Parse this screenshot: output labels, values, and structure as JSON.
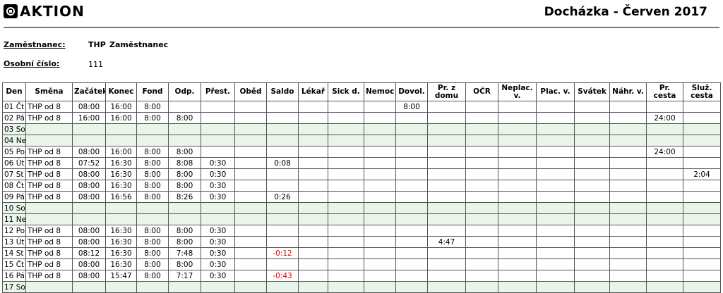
{
  "header": {
    "logo_text": "AKTION",
    "title": "Docházka - Červen 2017"
  },
  "info": {
    "employee_label": "Zaměstnanec:",
    "employee_short": "THP",
    "employee_name": "Zaměstnanec",
    "id_label": "Osobní číslo:",
    "id_value": "111"
  },
  "columns": [
    "Den",
    "Směna",
    "Začátek",
    "Konec",
    "Fond",
    "Odp.",
    "Přest.",
    "Oběd",
    "Saldo",
    "Lékař",
    "Sick d.",
    "Nemoc",
    "Dovol.",
    "Pr. z domu",
    "OČR",
    "Neplac. v.",
    "Plac. v.",
    "Svátek",
    "Náhr. v.",
    "Pr. cesta",
    "Služ. cesta"
  ],
  "rows": [
    {
      "den": "01 Čt",
      "smena": "THP od 8",
      "zacatek": "08:00",
      "konec": "16:00",
      "fond": "8:00",
      "odp": "",
      "prest": "",
      "obed": "",
      "saldo": "",
      "dovol": "8:00",
      "prdomu": "",
      "prcesta": "",
      "sluzcesta": "",
      "weekend": false,
      "neg": false
    },
    {
      "den": "02 Pá",
      "smena": "THP od 8",
      "zacatek": "16:00",
      "konec": "16:00",
      "fond": "8:00",
      "odp": "8:00",
      "prest": "",
      "obed": "",
      "saldo": "",
      "dovol": "",
      "prdomu": "",
      "prcesta": "24:00",
      "sluzcesta": "",
      "weekend": false,
      "neg": false
    },
    {
      "den": "03 So",
      "smena": "",
      "zacatek": "",
      "konec": "",
      "fond": "",
      "odp": "",
      "prest": "",
      "obed": "",
      "saldo": "",
      "dovol": "",
      "prdomu": "",
      "prcesta": "",
      "sluzcesta": "",
      "weekend": true,
      "neg": false
    },
    {
      "den": "04 Ne",
      "smena": "",
      "zacatek": "",
      "konec": "",
      "fond": "",
      "odp": "",
      "prest": "",
      "obed": "",
      "saldo": "",
      "dovol": "",
      "prdomu": "",
      "prcesta": "",
      "sluzcesta": "",
      "weekend": true,
      "neg": false
    },
    {
      "den": "05 Po",
      "smena": "THP od 8",
      "zacatek": "08:00",
      "konec": "16:00",
      "fond": "8:00",
      "odp": "8:00",
      "prest": "",
      "obed": "",
      "saldo": "",
      "dovol": "",
      "prdomu": "",
      "prcesta": "24:00",
      "sluzcesta": "",
      "weekend": false,
      "neg": false
    },
    {
      "den": "06 Út",
      "smena": "THP od 8",
      "zacatek": "07:52",
      "konec": "16:30",
      "fond": "8:00",
      "odp": "8:08",
      "prest": "0:30",
      "obed": "",
      "saldo": "0:08",
      "dovol": "",
      "prdomu": "",
      "prcesta": "",
      "sluzcesta": "",
      "weekend": false,
      "neg": false
    },
    {
      "den": "07 St",
      "smena": "THP od 8",
      "zacatek": "08:00",
      "konec": "16:30",
      "fond": "8:00",
      "odp": "8:00",
      "prest": "0:30",
      "obed": "",
      "saldo": "",
      "dovol": "",
      "prdomu": "",
      "prcesta": "",
      "sluzcesta": "2:04",
      "weekend": false,
      "neg": false
    },
    {
      "den": "08 Čt",
      "smena": "THP od 8",
      "zacatek": "08:00",
      "konec": "16:30",
      "fond": "8:00",
      "odp": "8:00",
      "prest": "0:30",
      "obed": "",
      "saldo": "",
      "dovol": "",
      "prdomu": "",
      "prcesta": "",
      "sluzcesta": "",
      "weekend": false,
      "neg": false
    },
    {
      "den": "09 Pá",
      "smena": "THP od 8",
      "zacatek": "08:00",
      "konec": "16:56",
      "fond": "8:00",
      "odp": "8:26",
      "prest": "0:30",
      "obed": "",
      "saldo": "0:26",
      "dovol": "",
      "prdomu": "",
      "prcesta": "",
      "sluzcesta": "",
      "weekend": false,
      "neg": false
    },
    {
      "den": "10 So",
      "smena": "",
      "zacatek": "",
      "konec": "",
      "fond": "",
      "odp": "",
      "prest": "",
      "obed": "",
      "saldo": "",
      "dovol": "",
      "prdomu": "",
      "prcesta": "",
      "sluzcesta": "",
      "weekend": true,
      "neg": false
    },
    {
      "den": "11 Ne",
      "smena": "",
      "zacatek": "",
      "konec": "",
      "fond": "",
      "odp": "",
      "prest": "",
      "obed": "",
      "saldo": "",
      "dovol": "",
      "prdomu": "",
      "prcesta": "",
      "sluzcesta": "",
      "weekend": true,
      "neg": false
    },
    {
      "den": "12 Po",
      "smena": "THP od 8",
      "zacatek": "08:00",
      "konec": "16:30",
      "fond": "8:00",
      "odp": "8:00",
      "prest": "0:30",
      "obed": "",
      "saldo": "",
      "dovol": "",
      "prdomu": "",
      "prcesta": "",
      "sluzcesta": "",
      "weekend": false,
      "neg": false
    },
    {
      "den": "13 Út",
      "smena": "THP od 8",
      "zacatek": "08:00",
      "konec": "16:30",
      "fond": "8:00",
      "odp": "8:00",
      "prest": "0:30",
      "obed": "",
      "saldo": "",
      "dovol": "",
      "prdomu": "4:47",
      "prcesta": "",
      "sluzcesta": "",
      "weekend": false,
      "neg": false
    },
    {
      "den": "14 St",
      "smena": "THP od 8",
      "zacatek": "08:12",
      "konec": "16:30",
      "fond": "8:00",
      "odp": "7:48",
      "prest": "0:30",
      "obed": "",
      "saldo": "-0:12",
      "dovol": "",
      "prdomu": "",
      "prcesta": "",
      "sluzcesta": "",
      "weekend": false,
      "neg": true
    },
    {
      "den": "15 Čt",
      "smena": "THP od 8",
      "zacatek": "08:00",
      "konec": "16:30",
      "fond": "8:00",
      "odp": "8:00",
      "prest": "0:30",
      "obed": "",
      "saldo": "",
      "dovol": "",
      "prdomu": "",
      "prcesta": "",
      "sluzcesta": "",
      "weekend": false,
      "neg": false
    },
    {
      "den": "16 Pá",
      "smena": "THP od 8",
      "zacatek": "08:00",
      "konec": "15:47",
      "fond": "8:00",
      "odp": "7:17",
      "prest": "0:30",
      "obed": "",
      "saldo": "-0:43",
      "dovol": "",
      "prdomu": "",
      "prcesta": "",
      "sluzcesta": "",
      "weekend": false,
      "neg": true
    },
    {
      "den": "17 So",
      "smena": "",
      "zacatek": "",
      "konec": "",
      "fond": "",
      "odp": "",
      "prest": "",
      "obed": "",
      "saldo": "",
      "dovol": "",
      "prdomu": "",
      "prcesta": "",
      "sluzcesta": "",
      "weekend": true,
      "neg": false
    }
  ],
  "colors": {
    "weekend_bg": "#eaf5e9",
    "negative": "#e00000"
  }
}
